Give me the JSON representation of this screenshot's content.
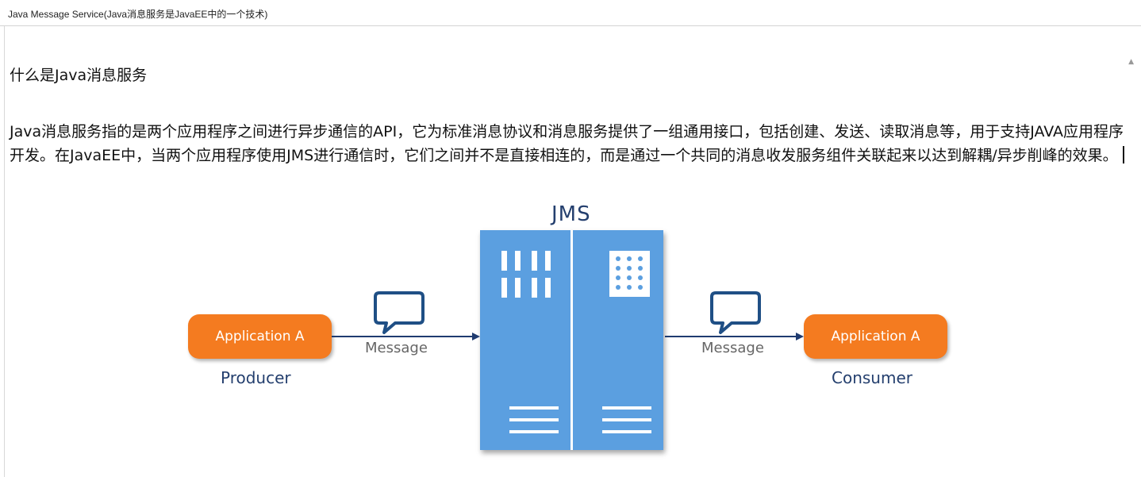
{
  "window": {
    "title": "Java Message Service(Java消息服务是JavaEE中的一个技术)"
  },
  "document": {
    "heading": "什么是Java消息服务",
    "paragraph": "Java消息服务指的是两个应用程序之间进行异步通信的API，它为标准消息协议和消息服务提供了一组通用接口，包括创建、发送、读取消息等，用于支持JAVA应用程序开发。在JavaEE中，当两个应用程序使用JMS进行通信时，它们之间并不是直接相连的，而是通过一个共同的消息收发服务组件关联起来以达到解耦/异步削峰的效果。"
  },
  "diagram": {
    "server_label": "JMS",
    "producer": {
      "app_label": "Application  A",
      "role": "Producer"
    },
    "consumer": {
      "app_label": "Application  A",
      "role": "Consumer"
    },
    "message_left": "Message",
    "message_right": "Message",
    "colors": {
      "server": "#5b9fe0",
      "app": "#f47b20",
      "text_dark_blue": "#243f6e",
      "arrow": "#1f3b70"
    },
    "icons": [
      "message-bubble-icon",
      "server-bars-icon",
      "server-grid-icon",
      "server-lines-icon"
    ]
  }
}
